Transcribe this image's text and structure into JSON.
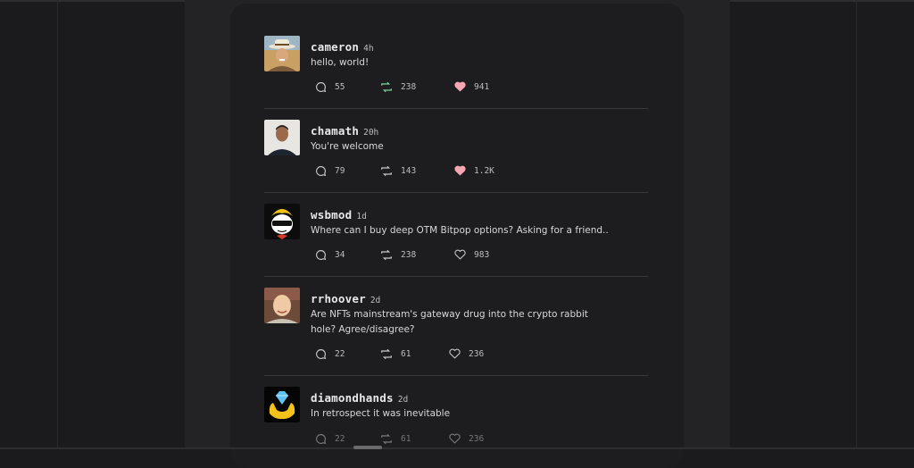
{
  "posts": [
    {
      "name": "cameron",
      "time": "4h",
      "text": "hello, world!",
      "replies": "55",
      "reposts": "238",
      "likes": "941",
      "liked": true,
      "reposted": true
    },
    {
      "name": "chamath",
      "time": "20h",
      "text": "You're welcome",
      "replies": "79",
      "reposts": "143",
      "likes": "1.2K",
      "liked": true,
      "reposted": false
    },
    {
      "name": "wsbmod",
      "time": "1d",
      "text": "Where can I buy deep OTM Bitpop options? Asking for a friend..",
      "replies": "34",
      "reposts": "238",
      "likes": "983",
      "liked": false,
      "reposted": false
    },
    {
      "name": "rrhoover",
      "time": "2d",
      "text": "Are NFTs mainstream's gateway drug into the crypto rabbit hole? Agree/disagree?",
      "replies": "22",
      "reposts": "61",
      "likes": "236",
      "liked": false,
      "reposted": false
    },
    {
      "name": "diamondhands",
      "time": "2d",
      "text": "In retrospect it was inevitable",
      "replies": "22",
      "reposts": "61",
      "likes": "236",
      "liked": false,
      "reposted": false
    }
  ],
  "colors": {
    "like_active": "#f4a7b3",
    "repost_active": "#7fd6a1",
    "icon": "#c9c9c9"
  },
  "icons": {
    "reply": "speech-bubble",
    "repost": "retweet-arrows",
    "like": "heart"
  }
}
